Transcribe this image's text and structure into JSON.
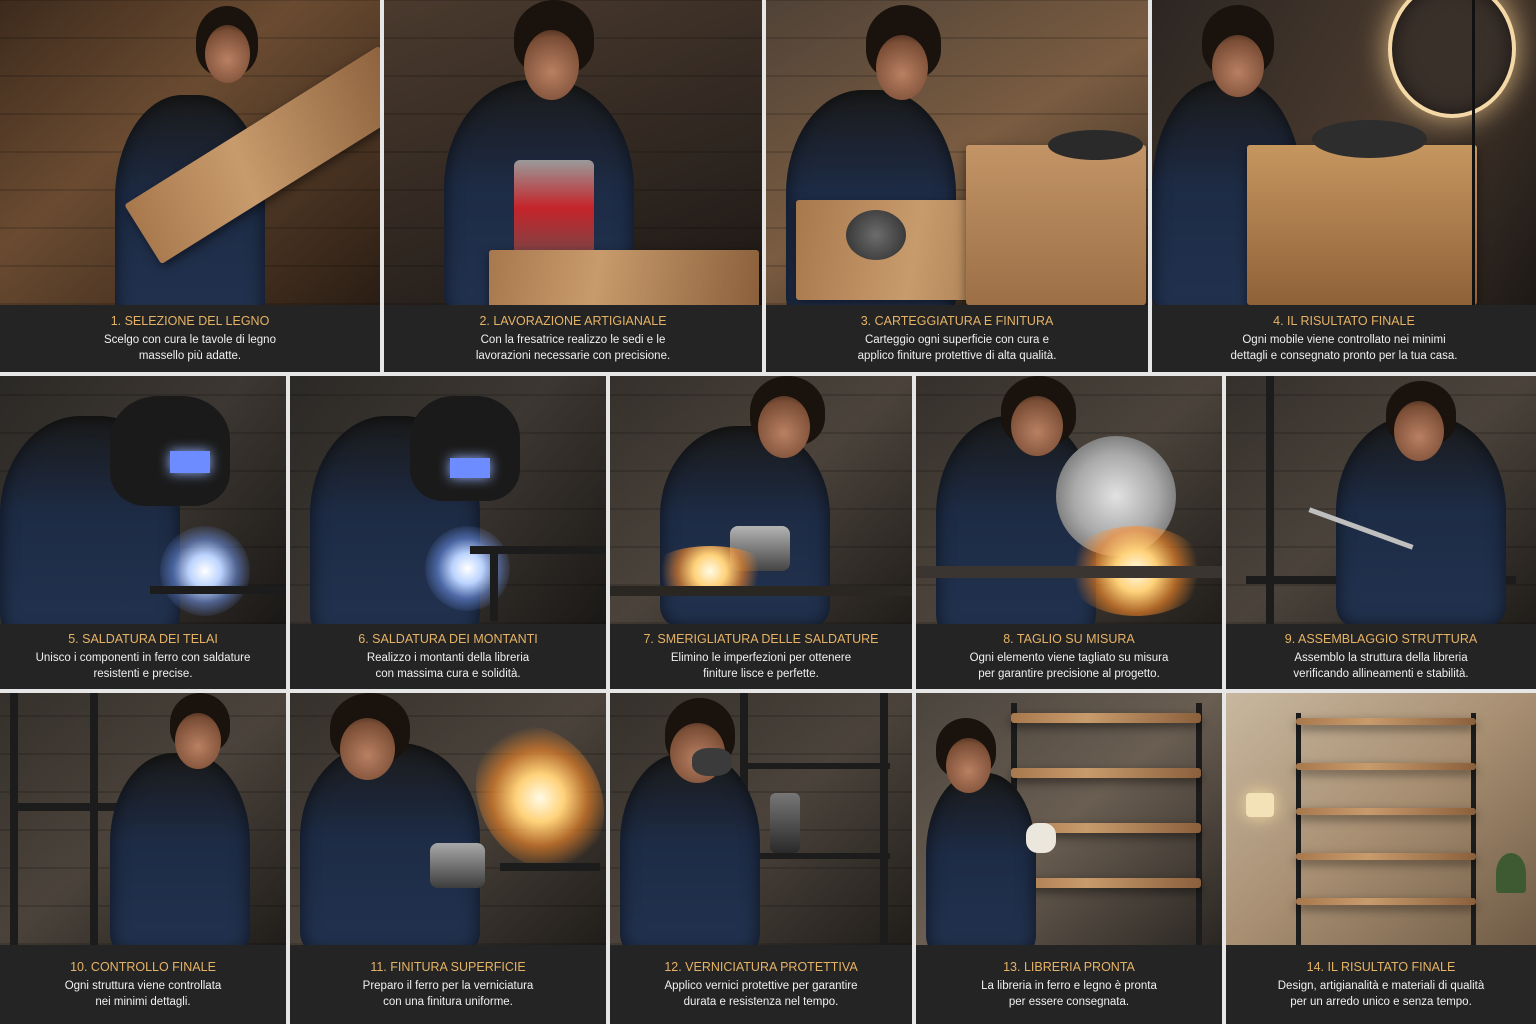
{
  "tiles": [
    {
      "title": "1. SELEZIONE DEL LEGNO",
      "desc": "Scelgo con cura le tavole di legno\nmassello più adatte."
    },
    {
      "title": "2. LAVORAZIONE ARTIGIANALE",
      "desc": "Con la fresatrice realizzo le sedi e le\nlavorazioni necessarie con precisione."
    },
    {
      "title": "3. CARTEGGIATURA E FINITURA",
      "desc": "Carteggio ogni superficie con cura e\napplico finiture protettive di alta qualità."
    },
    {
      "title": "4. IL RISULTATO FINALE",
      "desc": "Ogni mobile viene controllato nei minimi\ndettagli e consegnato pronto per la tua casa."
    },
    {
      "title": "5. SALDATURA DEI TELAI",
      "desc": "Unisco i componenti in ferro con saldature\nresistenti e precise."
    },
    {
      "title": "6. SALDATURA DEI MONTANTI",
      "desc": "Realizzo i montanti della libreria\ncon massima cura e solidità."
    },
    {
      "title": "7. SMERIGLIATURA DELLE SALDATURE",
      "desc": "Elimino le imperfezioni per ottenere\nfiniture lisce e perfette."
    },
    {
      "title": "8. TAGLIO SU MISURA",
      "desc": "Ogni elemento viene tagliato su misura\nper garantire precisione al progetto."
    },
    {
      "title": "9. ASSEMBLAGGIO STRUTTURA",
      "desc": "Assemblo la struttura della libreria\nverificando allineamenti e stabilità."
    },
    {
      "title": "10. CONTROLLO FINALE",
      "desc": "Ogni struttura viene controllata\nnei minimi dettagli."
    },
    {
      "title": "11. FINITURA SUPERFICIE",
      "desc": "Preparo il ferro per la verniciatura\ncon una finitura uniforme."
    },
    {
      "title": "12. VERNICIATURA PROTETTIVA",
      "desc": "Applico vernici protettive per garantire\ndurata e resistenza nel tempo."
    },
    {
      "title": "13. LIBRERIA PRONTA",
      "desc": "La libreria in ferro e legno è pronta\nper essere consegnata."
    },
    {
      "title": "14. IL RISULTATO FINALE",
      "desc": "Design, artigianalità e materiali di qualità\nper un arredo unico e senza tempo."
    }
  ],
  "colors": {
    "caption_bg": "#242424",
    "title_color": "#e6b366",
    "desc_color": "#f0f0f0"
  }
}
